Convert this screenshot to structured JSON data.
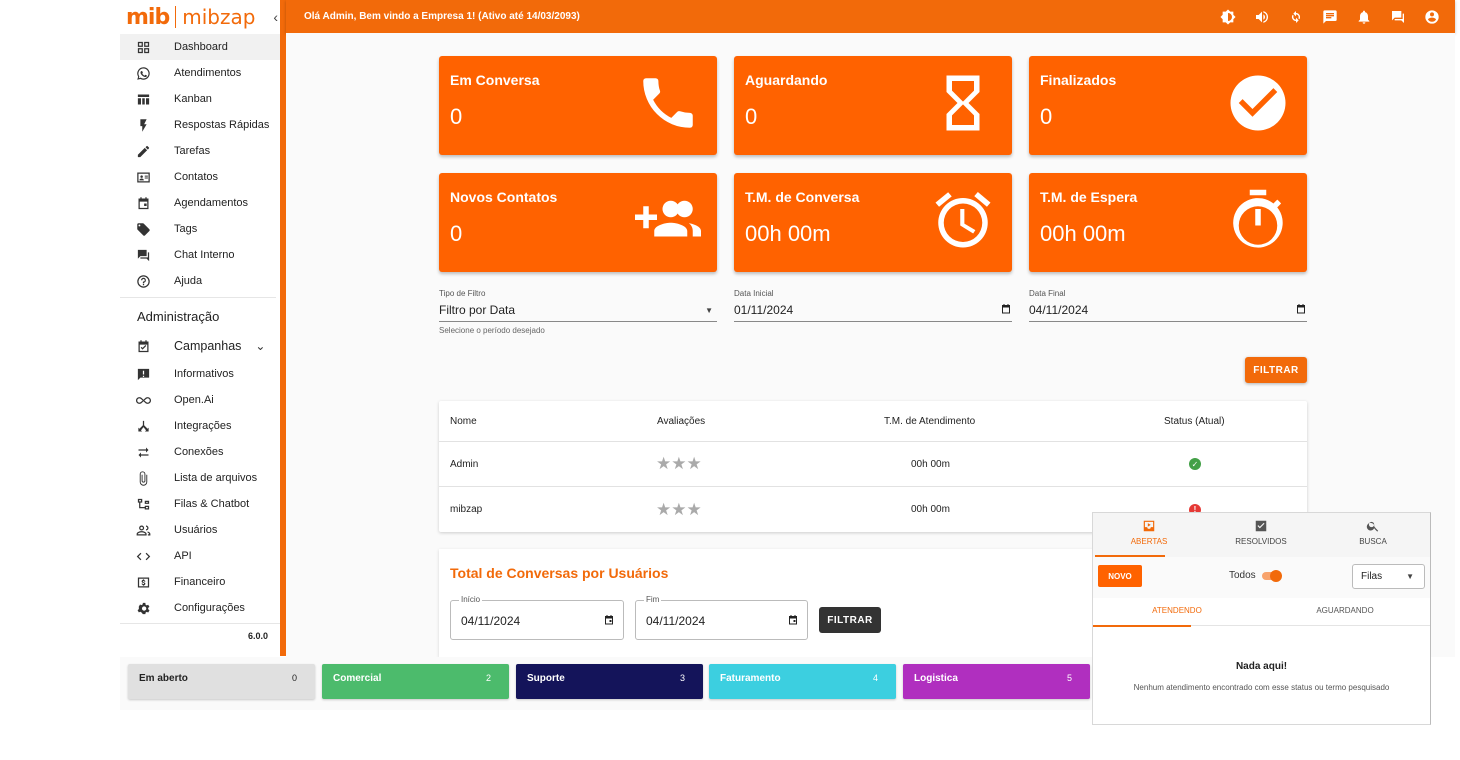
{
  "brand": {
    "logo_primary": "mib",
    "logo_secondary": "mibzap",
    "collapse_label": "‹"
  },
  "sidebar": {
    "items": [
      {
        "label": "Dashboard",
        "icon": "dashboard-icon"
      },
      {
        "label": "Atendimentos",
        "icon": "whatsapp-icon"
      },
      {
        "label": "Kanban",
        "icon": "kanban-icon"
      },
      {
        "label": "Respostas Rápidas",
        "icon": "flash-icon"
      },
      {
        "label": "Tarefas",
        "icon": "pencil-icon"
      },
      {
        "label": "Contatos",
        "icon": "contacts-icon"
      },
      {
        "label": "Agendamentos",
        "icon": "calendar-icon"
      },
      {
        "label": "Tags",
        "icon": "tag-icon"
      },
      {
        "label": "Chat Interno",
        "icon": "chat-icon"
      },
      {
        "label": "Ajuda",
        "icon": "help-icon"
      }
    ],
    "admin_section": "Administração",
    "campaigns": "Campanhas",
    "admin_items": [
      {
        "label": "Informativos",
        "icon": "announcement-icon"
      },
      {
        "label": "Open.Ai",
        "icon": "infinity-icon"
      },
      {
        "label": "Integrações",
        "icon": "integration-icon"
      },
      {
        "label": "Conexões",
        "icon": "swap-icon"
      },
      {
        "label": "Lista de arquivos",
        "icon": "paperclip-icon"
      },
      {
        "label": "Filas & Chatbot",
        "icon": "tree-icon"
      },
      {
        "label": "Usuários",
        "icon": "users-icon"
      },
      {
        "label": "API",
        "icon": "code-icon"
      },
      {
        "label": "Financeiro",
        "icon": "money-icon"
      },
      {
        "label": "Configurações",
        "icon": "settings-icon"
      }
    ],
    "version": "6.0.0"
  },
  "topbar": {
    "welcome": "Olá Admin, Bem vindo a Empresa 1! (Ativo até 14/03/2093)",
    "icons": [
      "theme-icon",
      "volume-icon",
      "refresh-icon",
      "message-icon",
      "bell-icon",
      "chat-icon",
      "account-icon"
    ]
  },
  "cards": [
    {
      "label": "Em Conversa",
      "value": "0",
      "icon": "phone-icon"
    },
    {
      "label": "Aguardando",
      "value": "0",
      "icon": "hourglass-icon"
    },
    {
      "label": "Finalizados",
      "value": "0",
      "icon": "check-circle-icon"
    },
    {
      "label": "Novos Contatos",
      "value": "0",
      "icon": "group-add-icon"
    },
    {
      "label": "T.M. de Conversa",
      "value": "00h 00m",
      "icon": "alarm-icon"
    },
    {
      "label": "T.M. de Espera",
      "value": "00h 00m",
      "icon": "timer-icon"
    }
  ],
  "filters": {
    "type_label": "Tipo de Filtro",
    "type_value": "Filtro por Data",
    "type_help": "Selecione o período desejado",
    "start_label": "Data Inicial",
    "start_value": "01/11/2024",
    "end_label": "Data Final",
    "end_value": "04/11/2024",
    "button": "FILTRAR"
  },
  "table": {
    "headers": [
      "Nome",
      "Avaliações",
      "T.M. de Atendimento",
      "Status (Atual)"
    ],
    "rows": [
      {
        "name": "Admin",
        "stars": "★★★",
        "time": "00h 00m",
        "status": "online",
        "status_color": "#43a047"
      },
      {
        "name": "mibzap",
        "stars": "★★★",
        "time": "00h 00m",
        "status": "offline",
        "status_color": "#e53935"
      }
    ]
  },
  "conversations": {
    "title": "Total de Conversas por Usuários",
    "start_label": "Início",
    "start_value": "04/11/2024",
    "end_label": "Fim",
    "end_value": "04/11/2024",
    "button": "FILTRAR"
  },
  "queues": [
    {
      "name": "Em aberto",
      "count": "0",
      "bg": "#e0e0e0",
      "fg": "#222222"
    },
    {
      "name": "Comercial",
      "count": "2",
      "bg": "#4cbb6c",
      "fg": "#ffffff"
    },
    {
      "name": "Suporte",
      "count": "3",
      "bg": "#14145a",
      "fg": "#ffffff"
    },
    {
      "name": "Faturamento",
      "count": "4",
      "bg": "#3ccfe0",
      "fg": "#ffffff"
    },
    {
      "name": "Logistica",
      "count": "5",
      "bg": "#b02fbf",
      "fg": "#ffffff"
    }
  ],
  "tickets": {
    "tabs": [
      {
        "label": "ABERTAS",
        "icon": "inbox-icon"
      },
      {
        "label": "RESOLVIDOS",
        "icon": "done-box-icon"
      },
      {
        "label": "BUSCA",
        "icon": "search-icon"
      }
    ],
    "new_button": "NOVO",
    "all_label": "Todos",
    "queue_select": "Filas",
    "subtabs": [
      "ATENDENDO",
      "AGUARDANDO"
    ],
    "empty_title": "Nada aqui!",
    "empty_text": "Nenhum atendimento encontrado com esse status ou termo pesquisado"
  },
  "colors": {
    "accent": "#f26a0a",
    "card": "#ff6200"
  }
}
